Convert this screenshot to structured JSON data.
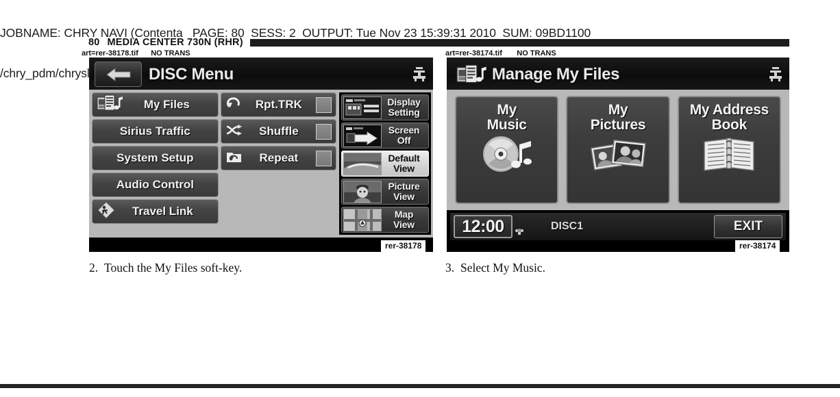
{
  "job_header": {
    "line1": "JOBNAME: CHRY NAVI (Contenta   PAGE: 80  SESS: 2  OUTPUT: Tue Nov 23 15:39:31 2010  SUM: 09BD1100",
    "line2": "/chry_pdm/chrysler/navi/rhr/navi"
  },
  "page_title": {
    "page_number": "80",
    "title": "MEDIA CENTER 730N (RHR)"
  },
  "art_credits": {
    "left": "art=rer-38178.tif      NO TRANS",
    "right": "art=rer-38174.tif       NO TRANS"
  },
  "figures": {
    "left_tag": "rer-38178",
    "right_tag": "rer-38174"
  },
  "left_screen": {
    "title": "DISC Menu",
    "back_icon": "back-arrow-icon",
    "eject_icon": "eject-icon",
    "col_a": [
      {
        "label": "My Files",
        "icon": "media-files-icon"
      },
      {
        "label": "Sirius Traffic",
        "icon": ""
      },
      {
        "label": "System Setup",
        "icon": ""
      },
      {
        "label": "Audio Control",
        "icon": ""
      },
      {
        "label": "Travel Link",
        "icon": "travel-link-icon"
      }
    ],
    "col_b": [
      {
        "label": "Rpt.TRK",
        "icon": "repeat-track-icon",
        "checked": false
      },
      {
        "label": "Shuffle",
        "icon": "shuffle-icon",
        "checked": false
      },
      {
        "label": "Repeat",
        "icon": "repeat-folder-icon",
        "checked": false
      }
    ],
    "col_c": [
      {
        "line1": "Display",
        "line2": "Setting",
        "icon": "display-setting-thumb",
        "selected": false
      },
      {
        "line1": "Screen",
        "line2": "Off",
        "icon": "screen-off-thumb",
        "selected": false
      },
      {
        "line1": "Default",
        "line2": "View",
        "icon": "default-view-thumb",
        "selected": true
      },
      {
        "line1": "Picture",
        "line2": "View",
        "icon": "picture-view-thumb",
        "selected": false
      },
      {
        "line1": "Map",
        "line2": "View",
        "icon": "map-view-thumb",
        "selected": false
      }
    ]
  },
  "right_screen": {
    "title": "Manage My Files",
    "title_icon": "media-files-icon",
    "eject_icon": "eject-icon",
    "tiles": [
      {
        "line1": "My",
        "line2": "Music",
        "icon": "cd-music-note-icon"
      },
      {
        "line1": "My",
        "line2": "Pictures",
        "icon": "photos-stack-icon"
      },
      {
        "line1": "My Address",
        "line2": "Book",
        "icon": "address-book-icon"
      }
    ],
    "status": {
      "clock": "12:00",
      "clock_icon": "clock-adjust-icon",
      "source": "DISC1",
      "exit_label": "EXIT"
    }
  },
  "captions": {
    "left_num": "2.",
    "left_text": "Touch the My Files soft-key.",
    "right_num": "3.",
    "right_text": "Select My Music."
  },
  "colors": {
    "page_bg": "#ffffff",
    "ink": "#111111",
    "screen_bg": "#000000",
    "panel_gray": "#b8b8b8",
    "button_gray": "#434343",
    "selected_light": "#d6d6d6"
  }
}
